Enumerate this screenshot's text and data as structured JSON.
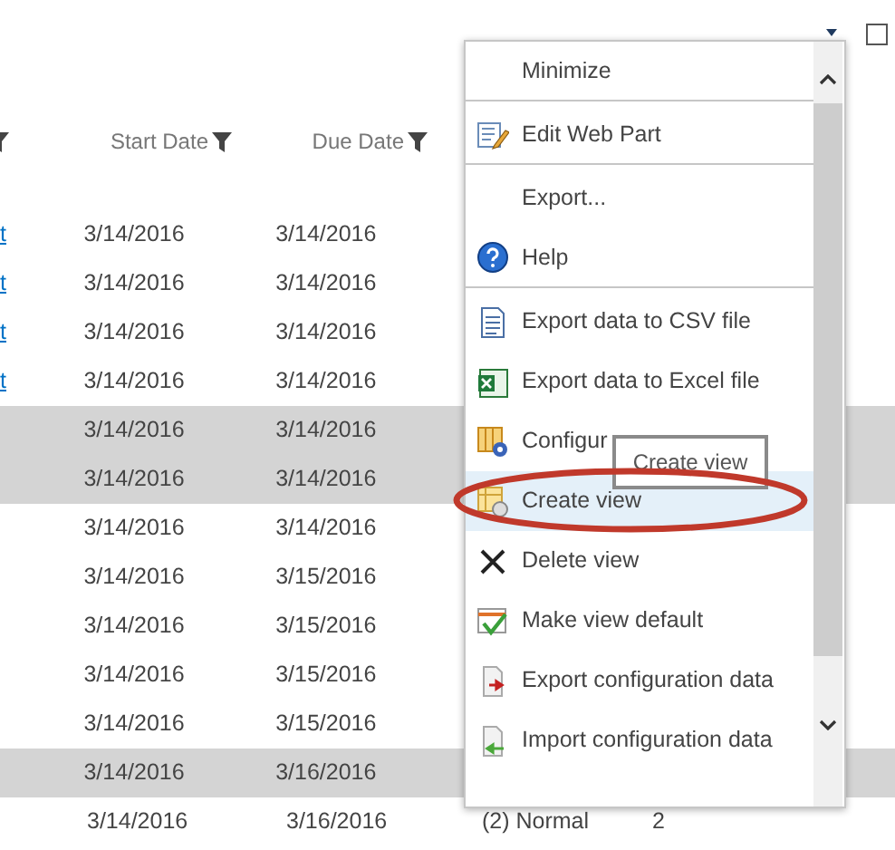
{
  "table": {
    "columns": [
      {
        "kind": "filter-only",
        "filter": true
      },
      {
        "kind": "labeled",
        "label": "Start Date",
        "filter": true
      },
      {
        "kind": "labeled",
        "label": "Due Date",
        "filter": true
      }
    ],
    "rows": [
      {
        "cells": [
          "t",
          "3/14/2016",
          "3/14/2016"
        ],
        "selected": false
      },
      {
        "cells": [
          "t",
          "3/14/2016",
          "3/14/2016"
        ],
        "selected": false
      },
      {
        "cells": [
          "t",
          "3/14/2016",
          "3/14/2016"
        ],
        "selected": false
      },
      {
        "cells": [
          "t",
          "3/14/2016",
          "3/14/2016"
        ],
        "selected": false
      },
      {
        "cells": [
          "",
          "3/14/2016",
          "3/14/2016"
        ],
        "selected": true
      },
      {
        "cells": [
          "",
          "3/14/2016",
          "3/14/2016"
        ],
        "selected": true
      },
      {
        "cells": [
          "",
          "3/14/2016",
          "3/14/2016"
        ],
        "selected": false
      },
      {
        "cells": [
          "",
          "3/14/2016",
          "3/15/2016"
        ],
        "selected": false
      },
      {
        "cells": [
          "",
          "3/14/2016",
          "3/15/2016"
        ],
        "selected": false
      },
      {
        "cells": [
          "",
          "3/14/2016",
          "3/15/2016"
        ],
        "selected": false
      },
      {
        "cells": [
          "",
          "3/14/2016",
          "3/15/2016"
        ],
        "selected": false
      },
      {
        "cells": [
          "",
          "3/14/2016",
          "3/16/2016"
        ],
        "selected": true
      },
      {
        "cells": [
          "",
          "3/14/2016",
          "3/16/2016",
          "(2) Normal",
          "2"
        ],
        "selected": false
      }
    ]
  },
  "menu": {
    "items": [
      {
        "label": "Minimize",
        "kind": "none",
        "divider_after": true,
        "selected": false
      },
      {
        "label": "Edit Web Part",
        "kind": "edit",
        "divider_after": true,
        "selected": false
      },
      {
        "label": "Export...",
        "kind": "none",
        "divider_after": false,
        "selected": false
      },
      {
        "label": "Help",
        "kind": "help",
        "divider_after": true,
        "selected": false
      },
      {
        "label": "Export data to CSV file",
        "kind": "csv",
        "divider_after": false,
        "selected": false
      },
      {
        "label": "Export data to Excel file",
        "kind": "excel",
        "divider_after": false,
        "selected": false
      },
      {
        "label": "Configur",
        "kind": "configure",
        "divider_after": false,
        "selected": false
      },
      {
        "label": "Create view",
        "kind": "create",
        "divider_after": false,
        "selected": true,
        "circled": true
      },
      {
        "label": "Delete view",
        "kind": "delete",
        "divider_after": false,
        "selected": false
      },
      {
        "label": "Make view default",
        "kind": "default",
        "divider_after": false,
        "selected": false
      },
      {
        "label": "Export configuration data",
        "kind": "export",
        "divider_after": false,
        "selected": false
      },
      {
        "label": "Import configuration data",
        "kind": "import",
        "divider_after": false,
        "selected": false
      }
    ]
  },
  "tooltip": "Create view",
  "webpart_checkbox": {
    "checked": false
  }
}
